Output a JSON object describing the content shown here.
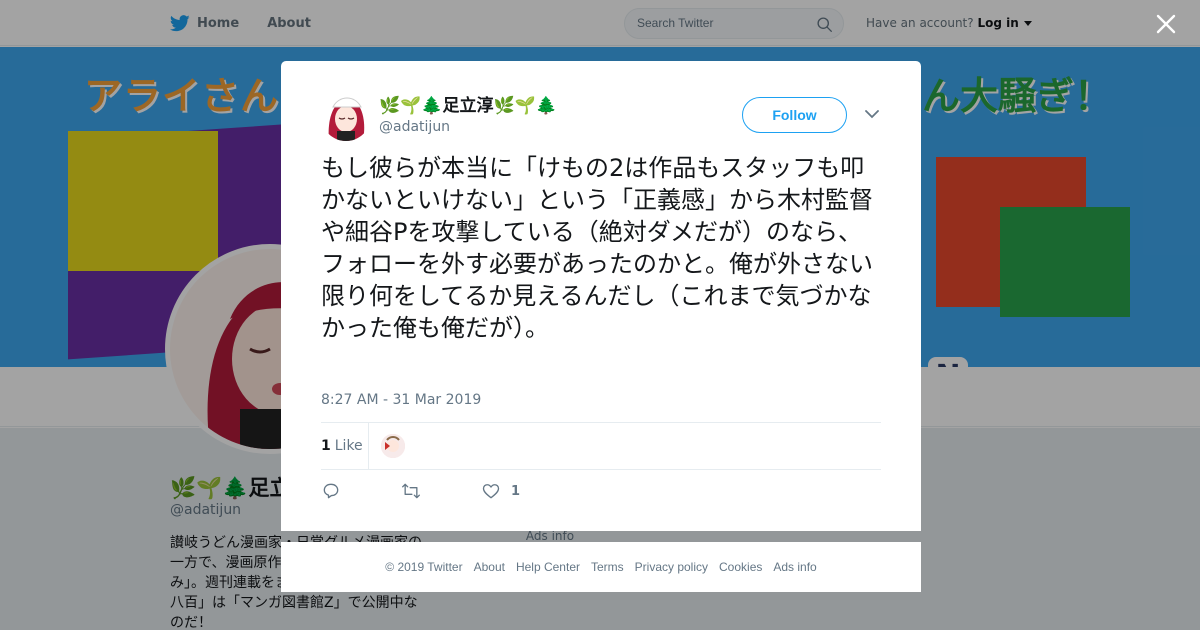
{
  "nav": {
    "home": "Home",
    "about": "About",
    "search_placeholder": "Search Twitter",
    "account_prompt": "Have an account?",
    "login": "Log in"
  },
  "banner": {
    "text_left": "アライさんと",
    "text_right": "ん大騒ぎ！",
    "badge": "N"
  },
  "profile": {
    "name": "🌿🌱🌲足立淳🌿🌱🌲",
    "handle": "@adatijun",
    "bio": "讃岐うどん漫画家・日常グルメ漫画家の一方で、漫画原作を担当した「野毛あさみ」。週刊連載をまとめた単行本「人間噂八百」は「マンガ図書館Z」で公開中なのだ！",
    "ads": "Ads info"
  },
  "tweet": {
    "author_name": "🌿🌱🌲足立淳🌿🌱🌲",
    "author_handle": "@adatijun",
    "follow": "Follow",
    "text": "もし彼らが本当に「けもの2は作品もスタッフも叩かないといけない」という「正義感」から木村監督や細谷Pを攻撃している（絶対ダメだが）のなら、フォローを外す必要があったのかと。俺が外さない限り何をしてるか見えるんだし（これまで気づかなかった俺も俺だが）。",
    "time": "8:27 AM - 31 Mar 2019",
    "like_count": "1",
    "like_label": "Like",
    "action_like_count": "1"
  },
  "footer": {
    "copyright": "© 2019 Twitter",
    "links": [
      "About",
      "Help Center",
      "Terms",
      "Privacy policy",
      "Cookies",
      "Ads info"
    ]
  },
  "colors": {
    "twitter_blue": "#1da1f2",
    "text_primary": "#14171a",
    "text_secondary": "#657786"
  },
  "icons": [
    "twitter-bird-icon",
    "search-icon",
    "caret-down-icon",
    "close-icon",
    "reply-icon",
    "retweet-icon",
    "heart-icon",
    "chevron-down-icon"
  ]
}
